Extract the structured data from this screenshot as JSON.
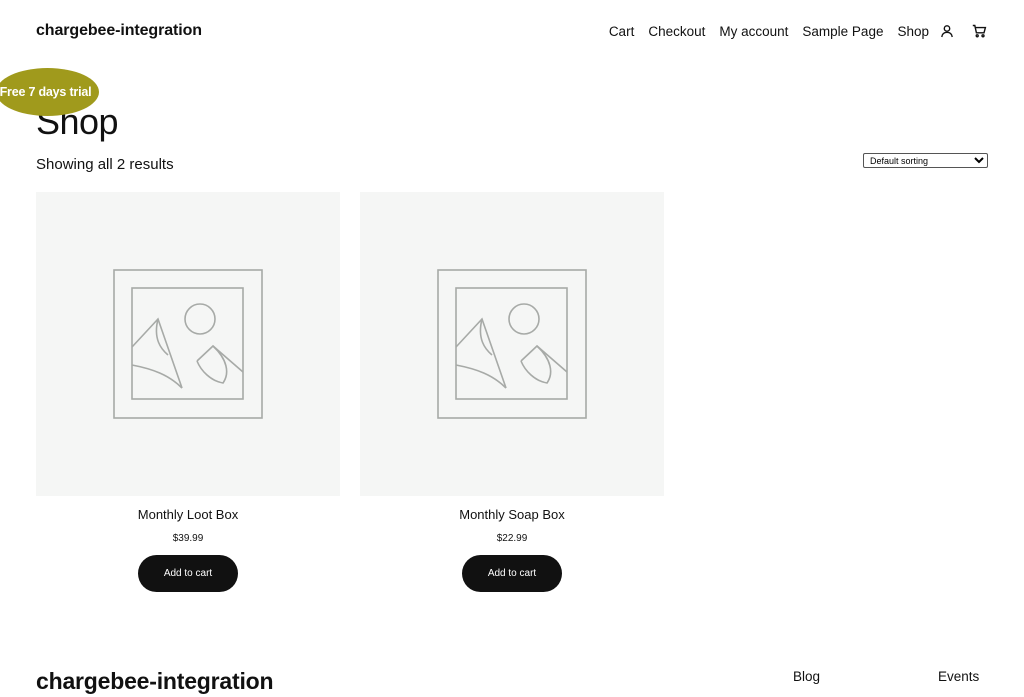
{
  "header": {
    "site_title": "chargebee-integration",
    "nav": [
      "Cart",
      "Checkout",
      "My account",
      "Sample Page",
      "Shop"
    ],
    "account_icon": "user-icon",
    "cart_icon": "cart-icon"
  },
  "badge": {
    "text": "Free 7 days trial",
    "color": "#a09a1c"
  },
  "page": {
    "title": "Shop",
    "result_count": "Showing all 2 results",
    "sorting": {
      "selected": "Default sorting"
    }
  },
  "products": [
    {
      "name": "Monthly Loot Box",
      "price": "$39.99",
      "button": "Add to cart",
      "image_icon": "image-placeholder-icon"
    },
    {
      "name": "Monthly Soap Box",
      "price": "$22.99",
      "button": "Add to cart",
      "image_icon": "image-placeholder-icon"
    }
  ],
  "footer": {
    "site_title": "chargebee-integration",
    "links": [
      "Blog",
      "Events"
    ]
  },
  "colors": {
    "button_bg": "#111111",
    "image_bg": "#f5f6f5",
    "text": "#111111"
  }
}
